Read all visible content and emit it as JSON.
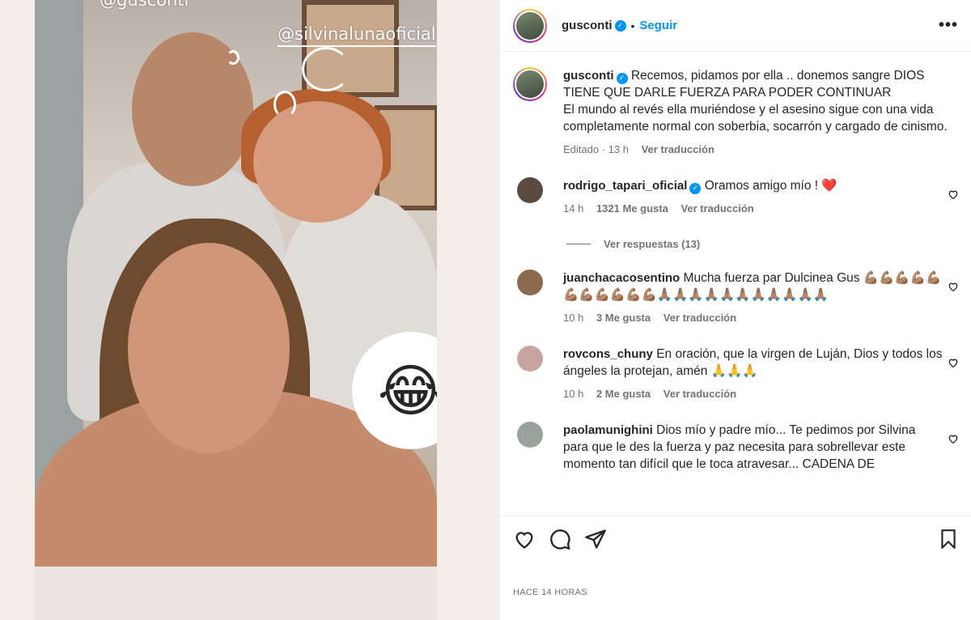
{
  "media": {
    "mention_top": "@gusconti",
    "mention_second": "@silvinalunaoficial",
    "sticker": "😂"
  },
  "header": {
    "username": "gusconti",
    "separator": "•",
    "follow_label": "Seguir",
    "more_label": "•••"
  },
  "caption": {
    "username": "gusconti",
    "line1": "Recemos, pidamos por ella .. donemos sangre DIOS TIENE QUE DARLE FUERZA PARA PODER CONTINUAR",
    "line2": "El mundo al revés ella muriéndose y el asesino sigue con una vida completamente normal con soberbia, socarrón y cargado de cinismo.",
    "edited": "Editado · 13 h",
    "translate": "Ver traducción"
  },
  "comments": [
    {
      "username": "rodrigo_tapari_oficial",
      "verified": true,
      "text": "Oramos amigo mío ! ❤️",
      "time": "14 h",
      "likes": "1321 Me gusta",
      "translate": "Ver traducción",
      "replies": "Ver respuestas (13)",
      "avatar_color": "#5a4a40"
    },
    {
      "username": "juanchacacosentino",
      "verified": false,
      "text": "Mucha fuerza par Dulcinea Gus 💪🏽💪🏽💪🏽💪🏽💪🏽💪🏽💪🏽💪🏽💪🏽💪🏽💪🏽🙏🏽🙏🏽🙏🏽🙏🏽🙏🏽🙏🏽🙏🏽🙏🏽🙏🏽🙏🏽🙏🏽",
      "time": "10 h",
      "likes": "3 Me gusta",
      "translate": "Ver traducción",
      "avatar_color": "#8c6a4e"
    },
    {
      "username": "rovcons_chuny",
      "verified": false,
      "text": "En oración, que la virgen de Luján, Dios y todos los ángeles la protejan, amén 🙏🙏🙏",
      "time": "10 h",
      "likes": "2 Me gusta",
      "translate": "Ver traducción",
      "avatar_color": "#c7a4a0"
    },
    {
      "username": "paolamunighini",
      "verified": false,
      "text": "Dios mío y padre mío... Te pedimos por Silvina para que le des la fuerza y paz necesita para sobrellevar este momento tan difícil que le toca atravesar... CADENA DE",
      "time": "",
      "likes": "",
      "translate": "",
      "avatar_color": "#9aa39b"
    }
  ],
  "footer": {
    "timestamp": "HACE 14 HORAS"
  },
  "colors": {
    "accent": "#0095f6",
    "muted": "#737373",
    "text": "#262626"
  }
}
